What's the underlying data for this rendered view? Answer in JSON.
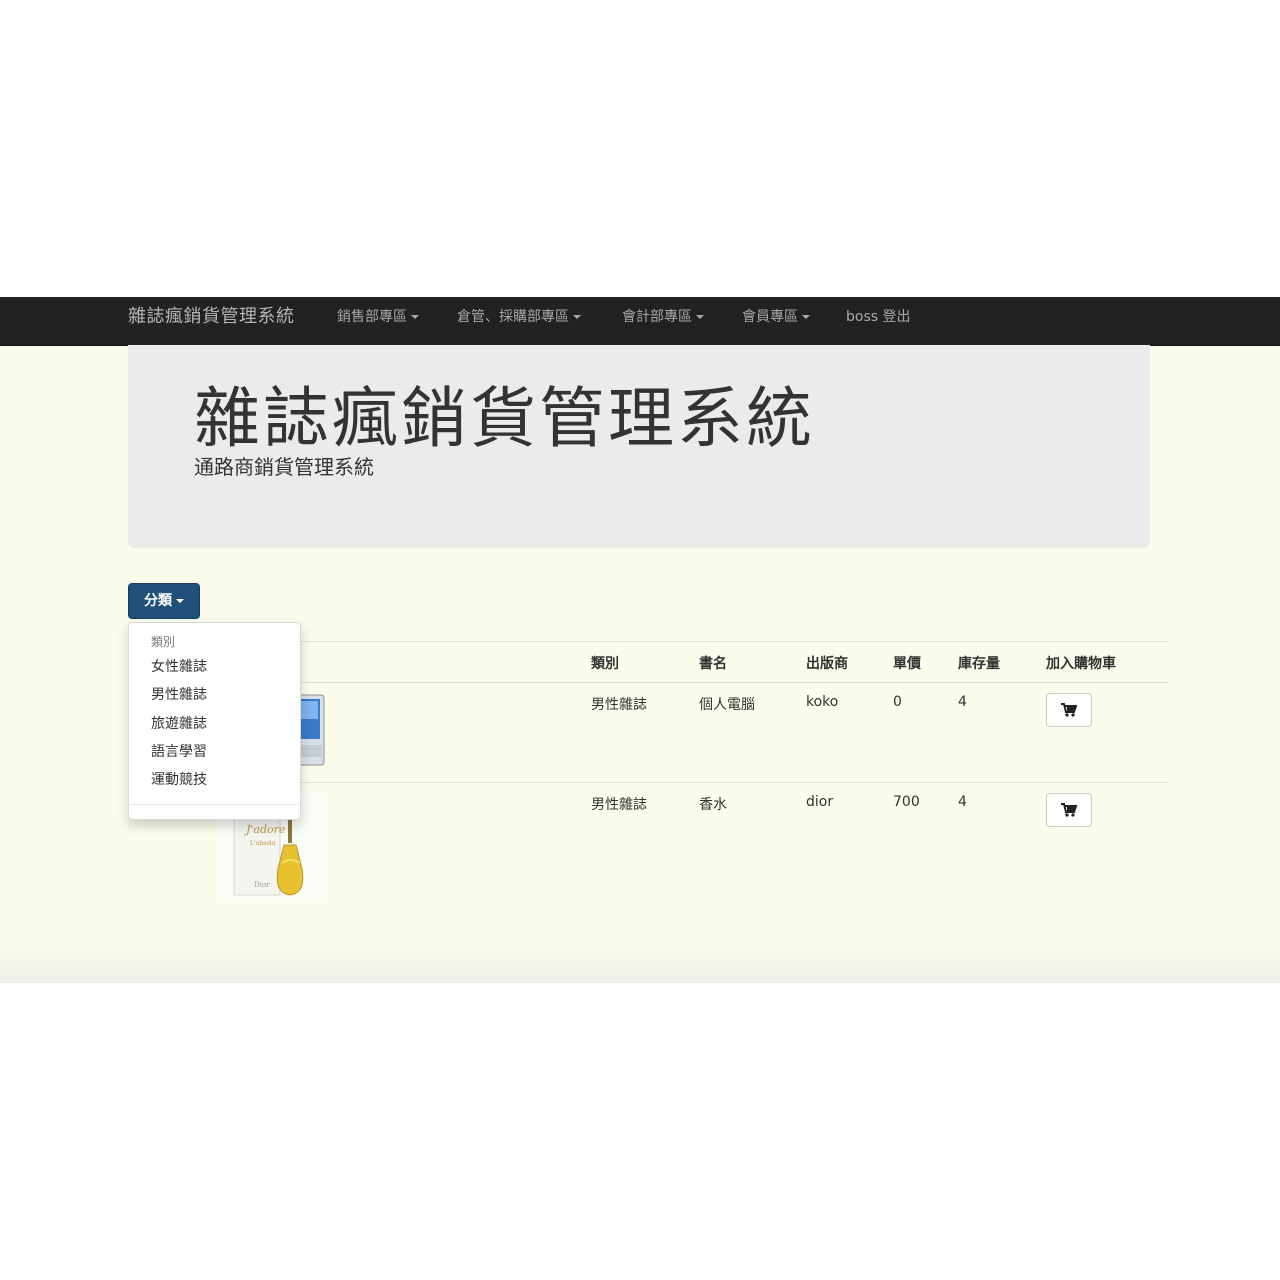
{
  "navbar": {
    "brand": "雜誌瘋銷貨管理系統",
    "items": [
      {
        "label": "銷售部專區",
        "dropdown": true
      },
      {
        "label": "倉管、採購部專區",
        "dropdown": true
      },
      {
        "label": "會計部專區",
        "dropdown": true
      },
      {
        "label": "會員專區",
        "dropdown": true
      },
      {
        "label": "boss 登出",
        "dropdown": false
      }
    ]
  },
  "jumbotron": {
    "title": "雜誌瘋銷貨管理系統",
    "subtitle": "通路商銷貨管理系統"
  },
  "category_dropdown": {
    "button_label": "分類",
    "header": "類別",
    "options": [
      "女性雜誌",
      "男性雜誌",
      "旅遊雜誌",
      "語言學習",
      "運動競技"
    ]
  },
  "table": {
    "headers": [
      "類別",
      "書名",
      "出版商",
      "單價",
      "庫存量",
      "加入購物車"
    ],
    "rows": [
      {
        "category": "男性雜誌",
        "title": "個人電腦",
        "publisher": "koko",
        "price": "0",
        "stock": "4",
        "image": "computer-monitor"
      },
      {
        "category": "男性雜誌",
        "title": "香水",
        "publisher": "dior",
        "price": "700",
        "stock": "4",
        "image": "perfume-bottle"
      }
    ],
    "cart_icon": "cart-icon"
  },
  "colors": {
    "navbar_bg": "#222222",
    "page_bg": "#fafdeb",
    "jumbotron_bg": "#ebebeb",
    "primary_button": "#21507a"
  }
}
